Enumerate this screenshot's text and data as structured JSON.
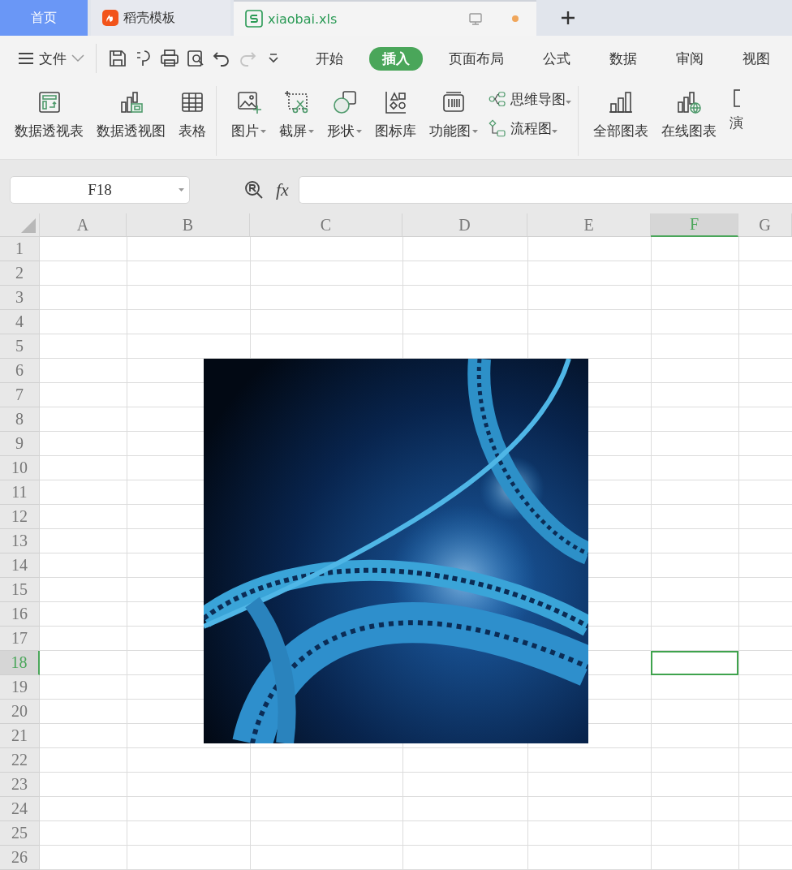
{
  "tabs": [
    {
      "label": "首页",
      "kind": "home",
      "selected": false
    },
    {
      "label": "稻壳模板",
      "kind": "docer",
      "selected": false
    },
    {
      "label": "xiaobai.xls",
      "kind": "sheet",
      "selected": true,
      "unsaved": true
    }
  ],
  "menu": {
    "file": "文件",
    "items": [
      {
        "label": "开始",
        "selected": false
      },
      {
        "label": "插入",
        "selected": true
      },
      {
        "label": "页面布局",
        "selected": false
      },
      {
        "label": "公式",
        "selected": false
      },
      {
        "label": "数据",
        "selected": false
      },
      {
        "label": "审阅",
        "selected": false
      },
      {
        "label": "视图",
        "selected": false
      }
    ]
  },
  "ribbon": {
    "groups": [
      [
        {
          "label": "数据透视表",
          "kind": "large",
          "dropdown": false
        },
        {
          "label": "数据透视图",
          "kind": "large",
          "dropdown": false
        },
        {
          "label": "表格",
          "kind": "large",
          "dropdown": false
        }
      ],
      [
        {
          "label": "图片",
          "kind": "large",
          "dropdown": true
        },
        {
          "label": "截屏",
          "kind": "large",
          "dropdown": true
        },
        {
          "label": "形状",
          "kind": "large",
          "dropdown": true
        },
        {
          "label": "图标库",
          "kind": "large",
          "dropdown": false
        },
        {
          "label": "功能图",
          "kind": "large",
          "dropdown": true
        },
        {
          "label": "思维导图",
          "kind": "small",
          "dropdown": true
        },
        {
          "label": "流程图",
          "kind": "small",
          "dropdown": true
        }
      ],
      [
        {
          "label": "全部图表",
          "kind": "large",
          "dropdown": false
        },
        {
          "label": "在线图表",
          "kind": "large",
          "dropdown": false
        },
        {
          "label": "演",
          "kind": "large",
          "dropdown": false
        }
      ]
    ]
  },
  "name_box": "F18",
  "formula_label": "fx",
  "sheet": {
    "columns": [
      {
        "label": "A",
        "selected": false
      },
      {
        "label": "B",
        "selected": false
      },
      {
        "label": "C",
        "selected": false
      },
      {
        "label": "D",
        "selected": false
      },
      {
        "label": "E",
        "selected": false
      },
      {
        "label": "F",
        "selected": true
      },
      {
        "label": "G",
        "selected": false
      }
    ],
    "rows": [
      {
        "label": "1",
        "selected": false
      },
      {
        "label": "2",
        "selected": false
      },
      {
        "label": "3",
        "selected": false
      },
      {
        "label": "4",
        "selected": false
      },
      {
        "label": "5",
        "selected": false
      },
      {
        "label": "6",
        "selected": false
      },
      {
        "label": "7",
        "selected": false
      },
      {
        "label": "8",
        "selected": false
      },
      {
        "label": "9",
        "selected": false
      },
      {
        "label": "10",
        "selected": false
      },
      {
        "label": "11",
        "selected": false
      },
      {
        "label": "12",
        "selected": false
      },
      {
        "label": "13",
        "selected": false
      },
      {
        "label": "14",
        "selected": false
      },
      {
        "label": "15",
        "selected": false
      },
      {
        "label": "16",
        "selected": false
      },
      {
        "label": "17",
        "selected": false
      },
      {
        "label": "18",
        "selected": true
      },
      {
        "label": "19",
        "selected": false
      },
      {
        "label": "20",
        "selected": false
      },
      {
        "label": "21",
        "selected": false
      },
      {
        "label": "22",
        "selected": false
      },
      {
        "label": "23",
        "selected": false
      },
      {
        "label": "24",
        "selected": false
      },
      {
        "label": "25",
        "selected": false
      },
      {
        "label": "26",
        "selected": false
      }
    ]
  }
}
